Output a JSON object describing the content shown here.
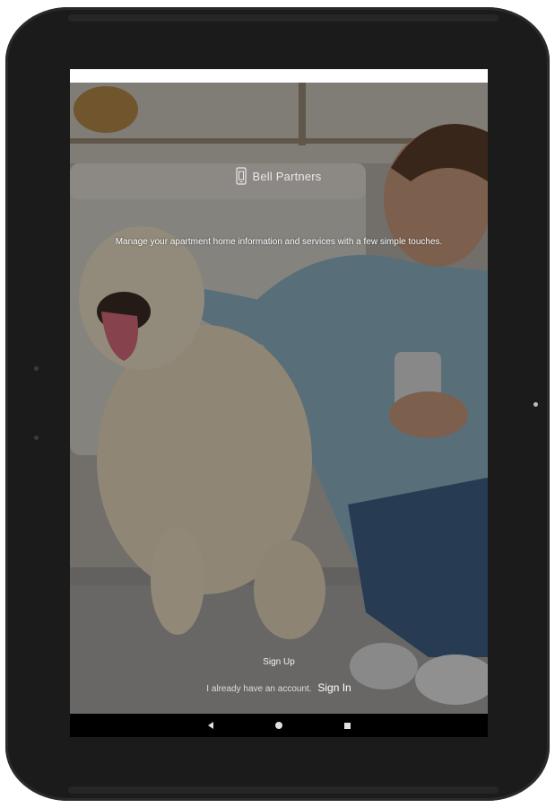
{
  "app": {
    "logo_text": "Bell Partners",
    "logo_icon": "phone-building-icon",
    "tagline": "Manage your apartment home information and services with a few simple touches."
  },
  "actions": {
    "sign_up_label": "Sign Up",
    "account_prompt": "I already have an account.",
    "sign_in_label": "Sign In"
  },
  "navigation": {
    "back_icon": "triangle-back-icon",
    "home_icon": "circle-home-icon",
    "recents_icon": "square-recents-icon"
  },
  "colors": {
    "bezel": "#1b1b1b",
    "nav_bar": "#000000",
    "text": "#ffffff"
  }
}
